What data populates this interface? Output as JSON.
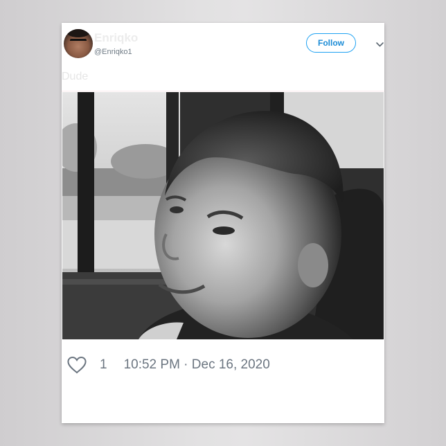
{
  "tweet": {
    "display_name": "Enriqko",
    "handle": "@Enriqko1",
    "follow_label": "Follow",
    "text": "Dude",
    "like_count": "1",
    "timestamp": "10:52 PM · Dec 16, 2020"
  },
  "icons": {
    "like": "heart-outline-icon",
    "more": "chevron-down-icon"
  },
  "colors": {
    "follow_accent": "#1da1f2",
    "metric_gray": "#6b7580"
  }
}
